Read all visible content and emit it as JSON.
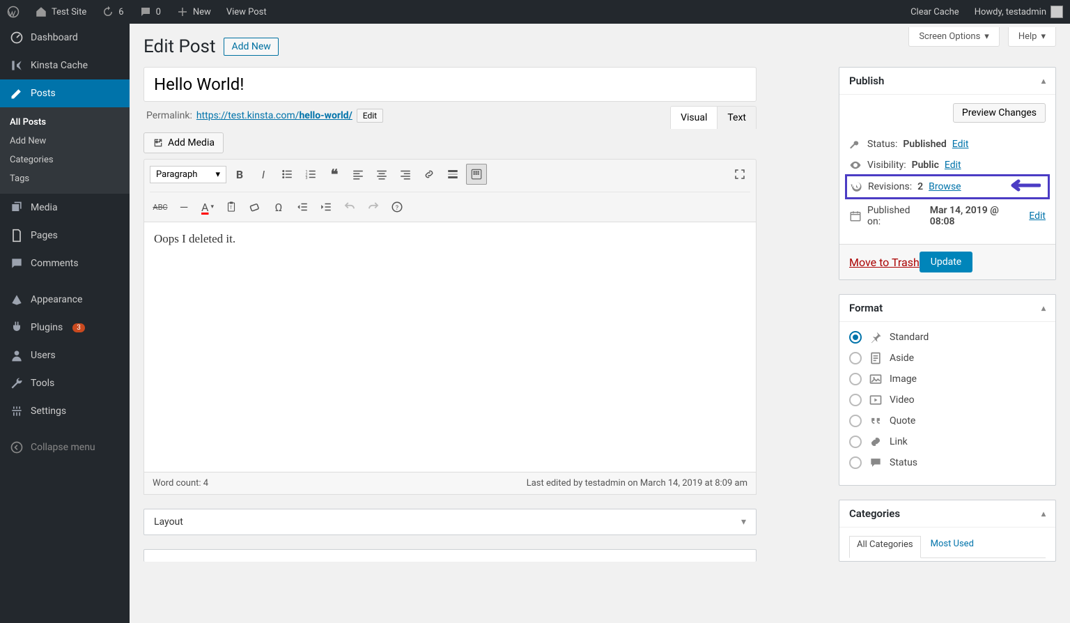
{
  "adminbar": {
    "site_name": "Test Site",
    "updates": "6",
    "comments": "0",
    "new": "New",
    "view_post": "View Post",
    "clear_cache": "Clear Cache",
    "howdy": "Howdy, testadmin"
  },
  "sidebar": {
    "dashboard": "Dashboard",
    "kinsta": "Kinsta Cache",
    "posts": "Posts",
    "sub_all": "All Posts",
    "sub_add": "Add New",
    "sub_cat": "Categories",
    "sub_tag": "Tags",
    "media": "Media",
    "pages": "Pages",
    "comments": "Comments",
    "appearance": "Appearance",
    "plugins": "Plugins",
    "plugins_badge": "3",
    "users": "Users",
    "tools": "Tools",
    "settings": "Settings",
    "collapse": "Collapse menu"
  },
  "screen": {
    "options": "Screen Options",
    "help": "Help"
  },
  "page": {
    "heading": "Edit Post",
    "add_new": "Add New",
    "title": "Hello World!",
    "permalink_label": "Permalink:",
    "permalink_base": "https://test.kinsta.com/",
    "permalink_slug": "hello-world/",
    "edit": "Edit",
    "add_media": "Add Media",
    "tab_visual": "Visual",
    "tab_text": "Text",
    "format_dd": "Paragraph",
    "body": "Oops I deleted it.",
    "word_count_label": "Word count: ",
    "word_count": "4",
    "last_edited": "Last edited by testadmin on March 14, 2019 at 8:09 am",
    "layout_box": "Layout"
  },
  "publish": {
    "title": "Publish",
    "preview": "Preview Changes",
    "status_label": "Status:",
    "status_value": "Published",
    "status_edit": "Edit",
    "visibility_label": "Visibility:",
    "visibility_value": "Public",
    "visibility_edit": "Edit",
    "revisions_label": "Revisions:",
    "revisions_count": "2",
    "revisions_browse": "Browse",
    "published_label": "Published on:",
    "published_value": "Mar 14, 2019 @ 08:08",
    "published_edit": "Edit",
    "trash": "Move to Trash",
    "update": "Update"
  },
  "format": {
    "title": "Format",
    "standard": "Standard",
    "aside": "Aside",
    "image": "Image",
    "video": "Video",
    "quote": "Quote",
    "link": "Link",
    "status": "Status"
  },
  "categories": {
    "title": "Categories",
    "all": "All Categories",
    "most_used": "Most Used"
  }
}
